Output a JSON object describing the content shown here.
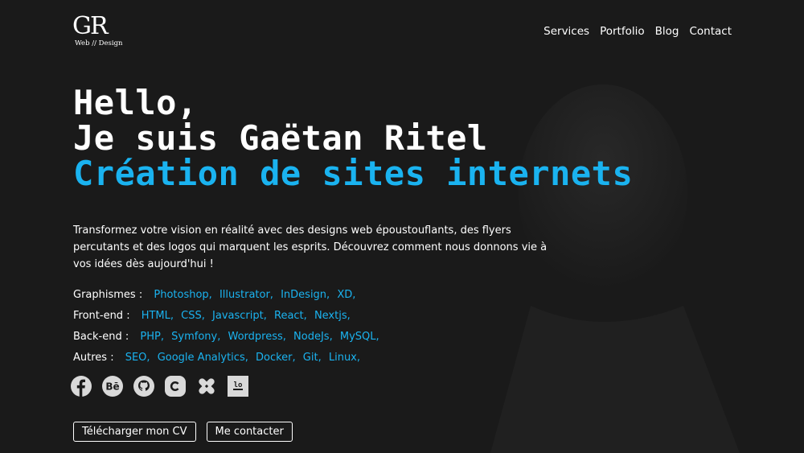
{
  "logo": {
    "mark": "GR",
    "subtitle": "Web // Design"
  },
  "nav": {
    "items": [
      "Services",
      "Portfolio",
      "Blog",
      "Contact"
    ]
  },
  "hero": {
    "line1": "Hello,",
    "line2": "Je suis Gaëtan Ritel",
    "line3": "Création de sites internets"
  },
  "intro": "Transformez votre vision en réalité avec des designs web époustouflants, des flyers percutants et des logos qui marquent les esprits. Découvrez comment nous donnons vie à vos idées dès aujourd'hui !",
  "skills": [
    {
      "label": "Graphismes :",
      "items": [
        "Photoshop,",
        "Illustrator,",
        "InDesign,",
        "XD,"
      ]
    },
    {
      "label": "Front-end :",
      "items": [
        "HTML,",
        "CSS,",
        "Javascript,",
        "React,",
        "Nextjs,"
      ]
    },
    {
      "label": "Back-end :",
      "items": [
        "PHP,",
        "Symfony,",
        "Wordpress,",
        "NodeJs,",
        "MySQL,"
      ]
    },
    {
      "label": "Autres :",
      "items": [
        "SEO,",
        "Google Analytics,",
        "Docker,",
        "Git,",
        "Linux,"
      ]
    }
  ],
  "socials": [
    "facebook-icon",
    "behance-icon",
    "github-icon",
    "codepen-icon",
    "malt-icon",
    "codinggame-icon"
  ],
  "buttons": {
    "cv": "Télécharger mon CV",
    "contact": "Me contacter"
  },
  "colors": {
    "background": "#1a1a1a",
    "accent": "#1ab3f0",
    "text": "#ffffff"
  }
}
